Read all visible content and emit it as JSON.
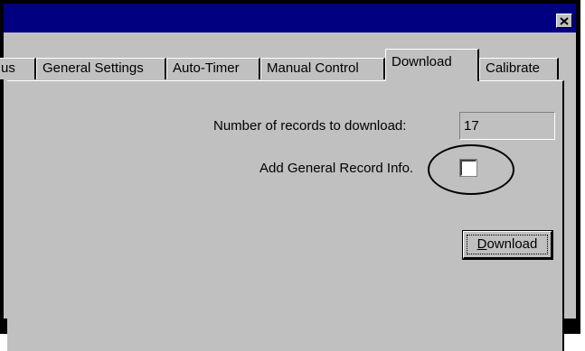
{
  "window": {
    "close_icon": "close-x-icon"
  },
  "tabs": [
    {
      "label": "us",
      "active": false
    },
    {
      "label": "General Settings",
      "active": false
    },
    {
      "label": "Auto-Timer",
      "active": false
    },
    {
      "label": "Manual Control",
      "active": false
    },
    {
      "label": "Download",
      "active": true
    },
    {
      "label": "Calibrate",
      "active": false
    }
  ],
  "download_page": {
    "records_label": "Number of records to download:",
    "records_value": "17",
    "general_info_label": "Add General Record Info.",
    "general_info_checked": false,
    "download_button": {
      "mnemonic": "D",
      "rest": "ownload"
    }
  },
  "colors": {
    "titlebar": "#000080",
    "face": "#c0c0c0",
    "frame": "#000000"
  }
}
